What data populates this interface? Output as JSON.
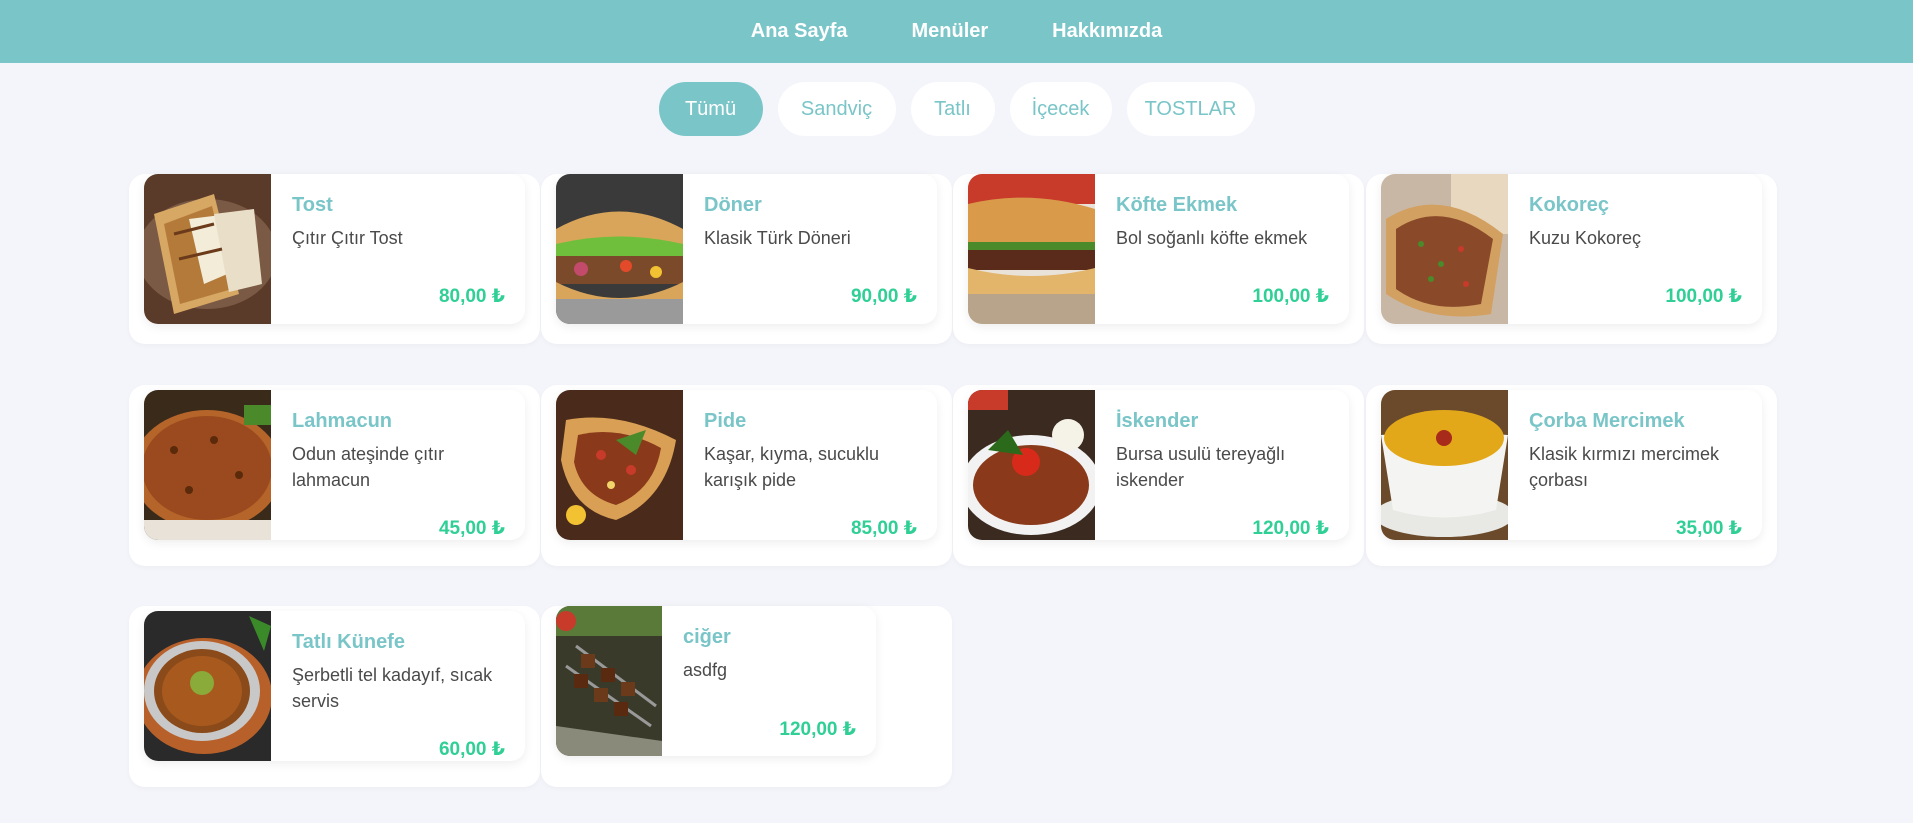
{
  "nav": {
    "items": [
      "Ana Sayfa",
      "Menüler",
      "Hakkımızda"
    ]
  },
  "filters": {
    "items": [
      "Tümü",
      "Sandviç",
      "Tatlı",
      "İçecek",
      "TOSTLAR"
    ],
    "active": "Tümü"
  },
  "colors": {
    "accent": "#79c5c8",
    "price": "#2fcf96",
    "background": "#f4f5fa"
  },
  "products": [
    {
      "name": "Tost",
      "desc": "Çıtır Çıtır Tost",
      "price": "80,00 ₺",
      "image": "toast-image"
    },
    {
      "name": "Döner",
      "desc": "Klasik Türk Döneri",
      "price": "90,00 ₺",
      "image": "doner-image"
    },
    {
      "name": "Köfte Ekmek",
      "desc": "Bol soğanlı köfte ekmek",
      "price": "100,00 ₺",
      "image": "kofte-image"
    },
    {
      "name": "Kokoreç",
      "desc": "Kuzu Kokoreç",
      "price": "100,00 ₺",
      "image": "kokorec-image"
    },
    {
      "name": "Lahmacun",
      "desc": "Odun ateşinde çıtır lahmacun",
      "price": "45,00 ₺",
      "image": "lahmacun-image"
    },
    {
      "name": "Pide",
      "desc": "Kaşar, kıyma, sucuklu karışık pide",
      "price": "85,00 ₺",
      "image": "pide-image"
    },
    {
      "name": "İskender",
      "desc": "Bursa usulü tereyağlı iskender",
      "price": "120,00 ₺",
      "image": "iskender-image"
    },
    {
      "name": "Çorba Mercimek",
      "desc": "Klasik kırmızı mercimek çorbası",
      "price": "35,00 ₺",
      "image": "soup-image"
    },
    {
      "name": "Tatlı Künefe",
      "desc": "Şerbetli tel kadayıf, sıcak servis",
      "price": "60,00 ₺",
      "image": "kunefe-image"
    },
    {
      "name": "ciğer",
      "desc": "asdfg",
      "price": "120,00 ₺",
      "image": "ciger-image"
    }
  ]
}
